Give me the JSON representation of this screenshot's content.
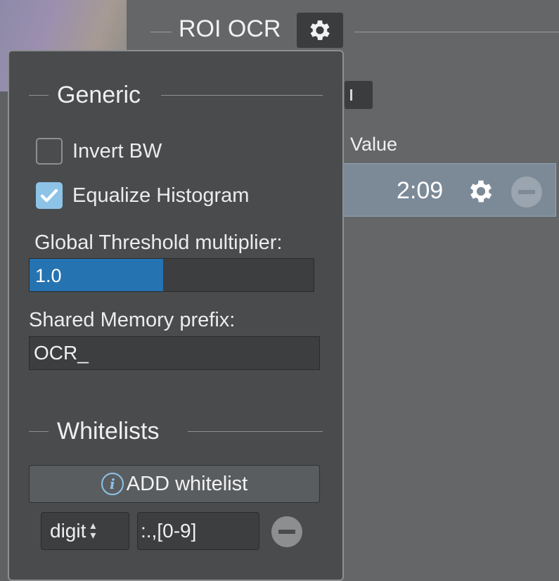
{
  "roi": {
    "title": "ROI OCR",
    "icon": "gear-icon"
  },
  "table": {
    "value_header": "Value",
    "row_value": "2:09"
  },
  "popup": {
    "generic_section": "Generic",
    "invert_bw": {
      "label": "Invert BW",
      "checked": false
    },
    "equalize_histogram": {
      "label": "Equalize Histogram",
      "checked": true
    },
    "threshold": {
      "label": "Global Threshold multiplier:",
      "value": "1.0",
      "fill_fraction": 0.47
    },
    "shared_memory": {
      "label": "Shared Memory prefix:",
      "value": "OCR_"
    },
    "whitelists_section": "Whitelists",
    "add_whitelist_label": "ADD whitelist",
    "info_glyph": "i",
    "whitelist": {
      "type": "digit",
      "pattern": ":.,[0-9]"
    }
  },
  "colors": {
    "accent": "#8ec3e8",
    "slider_fill": "#2673b2",
    "panel": "#494b4d",
    "selected_row": "#7c8a98"
  }
}
